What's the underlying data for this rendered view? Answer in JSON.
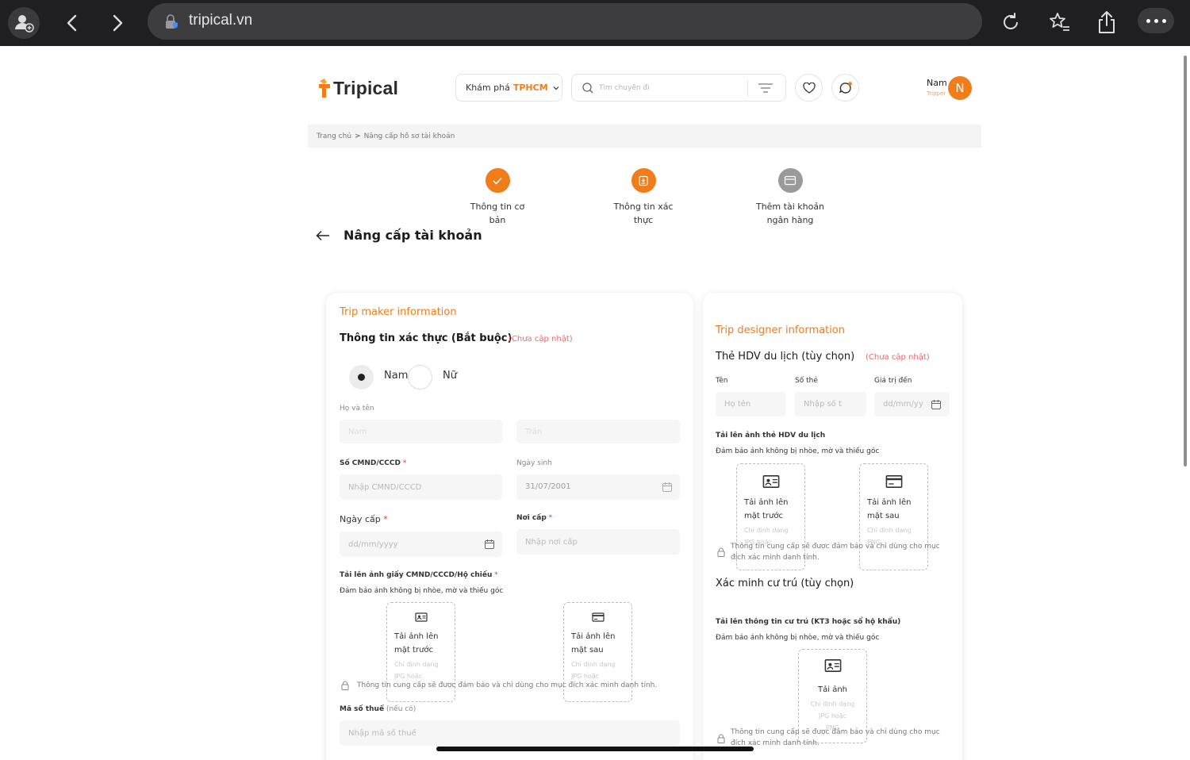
{
  "browser": {
    "url": "tripical.vn",
    "icons": [
      "profile-add-icon",
      "back-icon",
      "forward-icon",
      "site-lock-icon",
      "reload-icon",
      "favorites-icon",
      "share-icon",
      "more-icon"
    ]
  },
  "header": {
    "logo_text": "Tripical",
    "explore_label": "Khám phá",
    "explore_city": "TPHCM",
    "search_placeholder": "Tìm chuyến đi",
    "user_name": "Nam",
    "user_role": "Tripper",
    "avatar_initial": "N",
    "accent_color": "#f07c1a"
  },
  "breadcrumb": {
    "home": "Trang chủ",
    "separator": ">",
    "current": "Nâng cấp hồ sơ tài khoản"
  },
  "stepper": [
    {
      "label_line1": "Thông tin cơ",
      "label_line2": "bản",
      "state": "done",
      "icon": "check-icon"
    },
    {
      "label_line1": "Thông tin xác",
      "label_line2": "thực",
      "state": "active",
      "icon": "id-upload-icon"
    },
    {
      "label_line1": "Thêm tài khoản",
      "label_line2": "ngân hàng",
      "state": "inactive",
      "icon": "bank-card-icon"
    }
  ],
  "page_title": "Nâng cấp tài khoản",
  "left_card": {
    "section_title": "Trip maker information",
    "heading": "Thông tin xác thực (Bắt buộc)",
    "status": "(Chưa cập nhật)",
    "gender": {
      "options": [
        "Nam",
        "Nữ"
      ],
      "selected": "Nam"
    },
    "fullname_label": "Họ và tên",
    "first_name_placeholder": "Nam",
    "last_name_placeholder": "Trần",
    "id_label": "Số CMND/CCCD",
    "id_placeholder": "Nhập CMND/CCCD",
    "dob_label": "Ngày sinh",
    "dob_value": "31/07/2001",
    "issue_date_label": "Ngày cấp",
    "issue_date_placeholder": "dd/mm/yyyy",
    "issue_place_label": "Nơi cấp",
    "issue_place_placeholder": "Nhập nơi cấp",
    "upload_label": "Tải lên ảnh giấy CMND/CCCD/Hộ chiếu",
    "upload_hint": "Đảm bảo ảnh không bị nhòe, mờ và thiếu góc",
    "upload_front": {
      "line1": "Tải ảnh lên",
      "line2": "mặt trước",
      "fmt1": "Chỉ định dạng",
      "fmt2": "JPG hoặc"
    },
    "upload_back": {
      "line1": "Tải ảnh lên",
      "line2": "mặt sau",
      "fmt1": "Chỉ định dạng",
      "fmt2": "JPG hoặc"
    },
    "privacy_note": "Thông tin cung cấp sẽ được đảm bảo và chỉ dùng cho mục đích xác minh danh tính.",
    "tax_label": "Mã số thuế",
    "tax_optional": "(nếu có)",
    "tax_placeholder": "Nhập mã số thuế"
  },
  "right_card": {
    "section_title": "Trip designer information",
    "heading": "Thẻ HDV du lịch (tùy chọn)",
    "status": "(Chưa cập nhật)",
    "name_label": "Tên",
    "name_placeholder": "Họ tên",
    "card_no_label": "Số thẻ",
    "card_no_placeholder": "Nhập số t",
    "valid_label": "Giá trị đến",
    "valid_placeholder": "dd/mm/yy",
    "upload_label": "Tải lên ảnh thẻ HDV du lịch",
    "upload_hint": "Đảm bảo ảnh không bị nhòe, mờ và thiếu góc",
    "upload_front": {
      "line1": "Tải ảnh lên",
      "line2": "mặt trước",
      "fmt1": "Chỉ định dạng",
      "fmt2": "JPG hoặc"
    },
    "upload_back": {
      "line1": "Tải ảnh lên",
      "line2": "mặt sau",
      "fmt1": "Chỉ định dạng",
      "fmt2": "PNG"
    },
    "privacy_line1": "Thông tin cung cấp sẽ được đảm bảo và chỉ dùng cho mục",
    "privacy_line2": "đích xác minh danh tính.",
    "residence_heading": "Xác minh cư trú (tùy chọn)",
    "residence_upload_label": "Tải lên thông tin cư trú (KT3 hoặc sổ hộ khẩu)",
    "residence_upload_hint": "Đảm bảo ảnh không bị nhòe, mờ và thiếu góc",
    "residence_upload": {
      "line1": "Tải ảnh",
      "fmt1": "Chỉ định dạng",
      "fmt2": "JPG hoặc",
      "fmt3": "PNG"
    },
    "residence_privacy_line1": "Thông tin cung cấp sẽ được đảm bảo và chỉ dùng cho mục",
    "residence_privacy_line2": "đích xác minh danh tính."
  }
}
